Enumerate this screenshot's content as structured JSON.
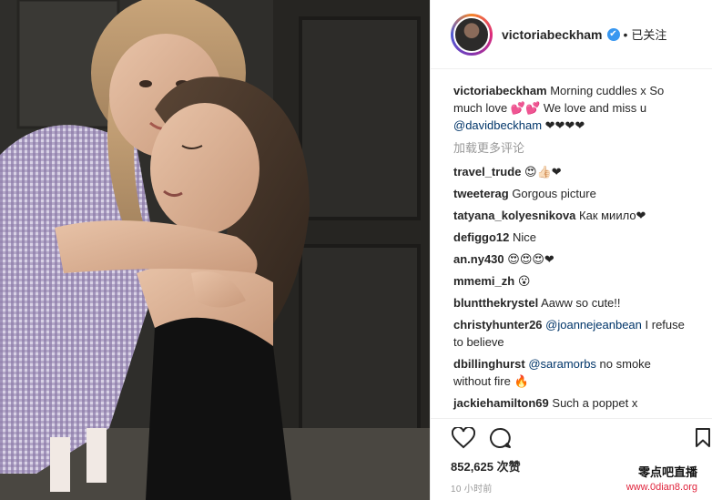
{
  "post": {
    "author": "victoriabeckham",
    "verified_glyph": "✔",
    "separator": "•",
    "follow_state": "已关注",
    "caption_text": " Morning cuddles x So much love 💕💕 We love and miss u ",
    "caption_mention": "@davidbeckham",
    "caption_tail": " ❤❤❤❤",
    "load_more": "加载更多评论"
  },
  "comments": [
    {
      "user": "travel_trude",
      "mention": "",
      "text": " 😍👍🏻❤"
    },
    {
      "user": "tweeterag",
      "mention": "",
      "text": " Gorgous picture"
    },
    {
      "user": "tatyana_kolyesnikova",
      "mention": "",
      "text": " Как миило❤"
    },
    {
      "user": "defiggo12",
      "mention": "",
      "text": " Nice"
    },
    {
      "user": "an.ny430",
      "mention": "",
      "text": " 😍😍😍❤"
    },
    {
      "user": "mmemi_zh",
      "mention": "",
      "text": " 😮"
    },
    {
      "user": "bluntthekrystel",
      "mention": "",
      "text": " Aaww so cute!!"
    },
    {
      "user": "christyhunter26",
      "mention": " @joannejeanbean",
      "text": " I refuse to believe"
    },
    {
      "user": "dbillinghurst",
      "mention": " @saramorbs",
      "text": " no smoke without fire 🔥"
    },
    {
      "user": "jackiehamilton69",
      "mention": "",
      "text": " Such a poppet x"
    }
  ],
  "actions": {
    "like_icon": "heart-outline-icon",
    "comment_icon": "comment-bubble-icon",
    "bookmark_icon": "bookmark-icon",
    "likes": "852,625 次赞",
    "time_ago": "10 小时前"
  },
  "watermark": {
    "line1": "零点吧直播",
    "line2": "www.0dian8.org"
  },
  "colors": {
    "link": "#003569",
    "verified": "#3897f0",
    "muted": "#999999",
    "watermark_red": "#e0233c"
  }
}
